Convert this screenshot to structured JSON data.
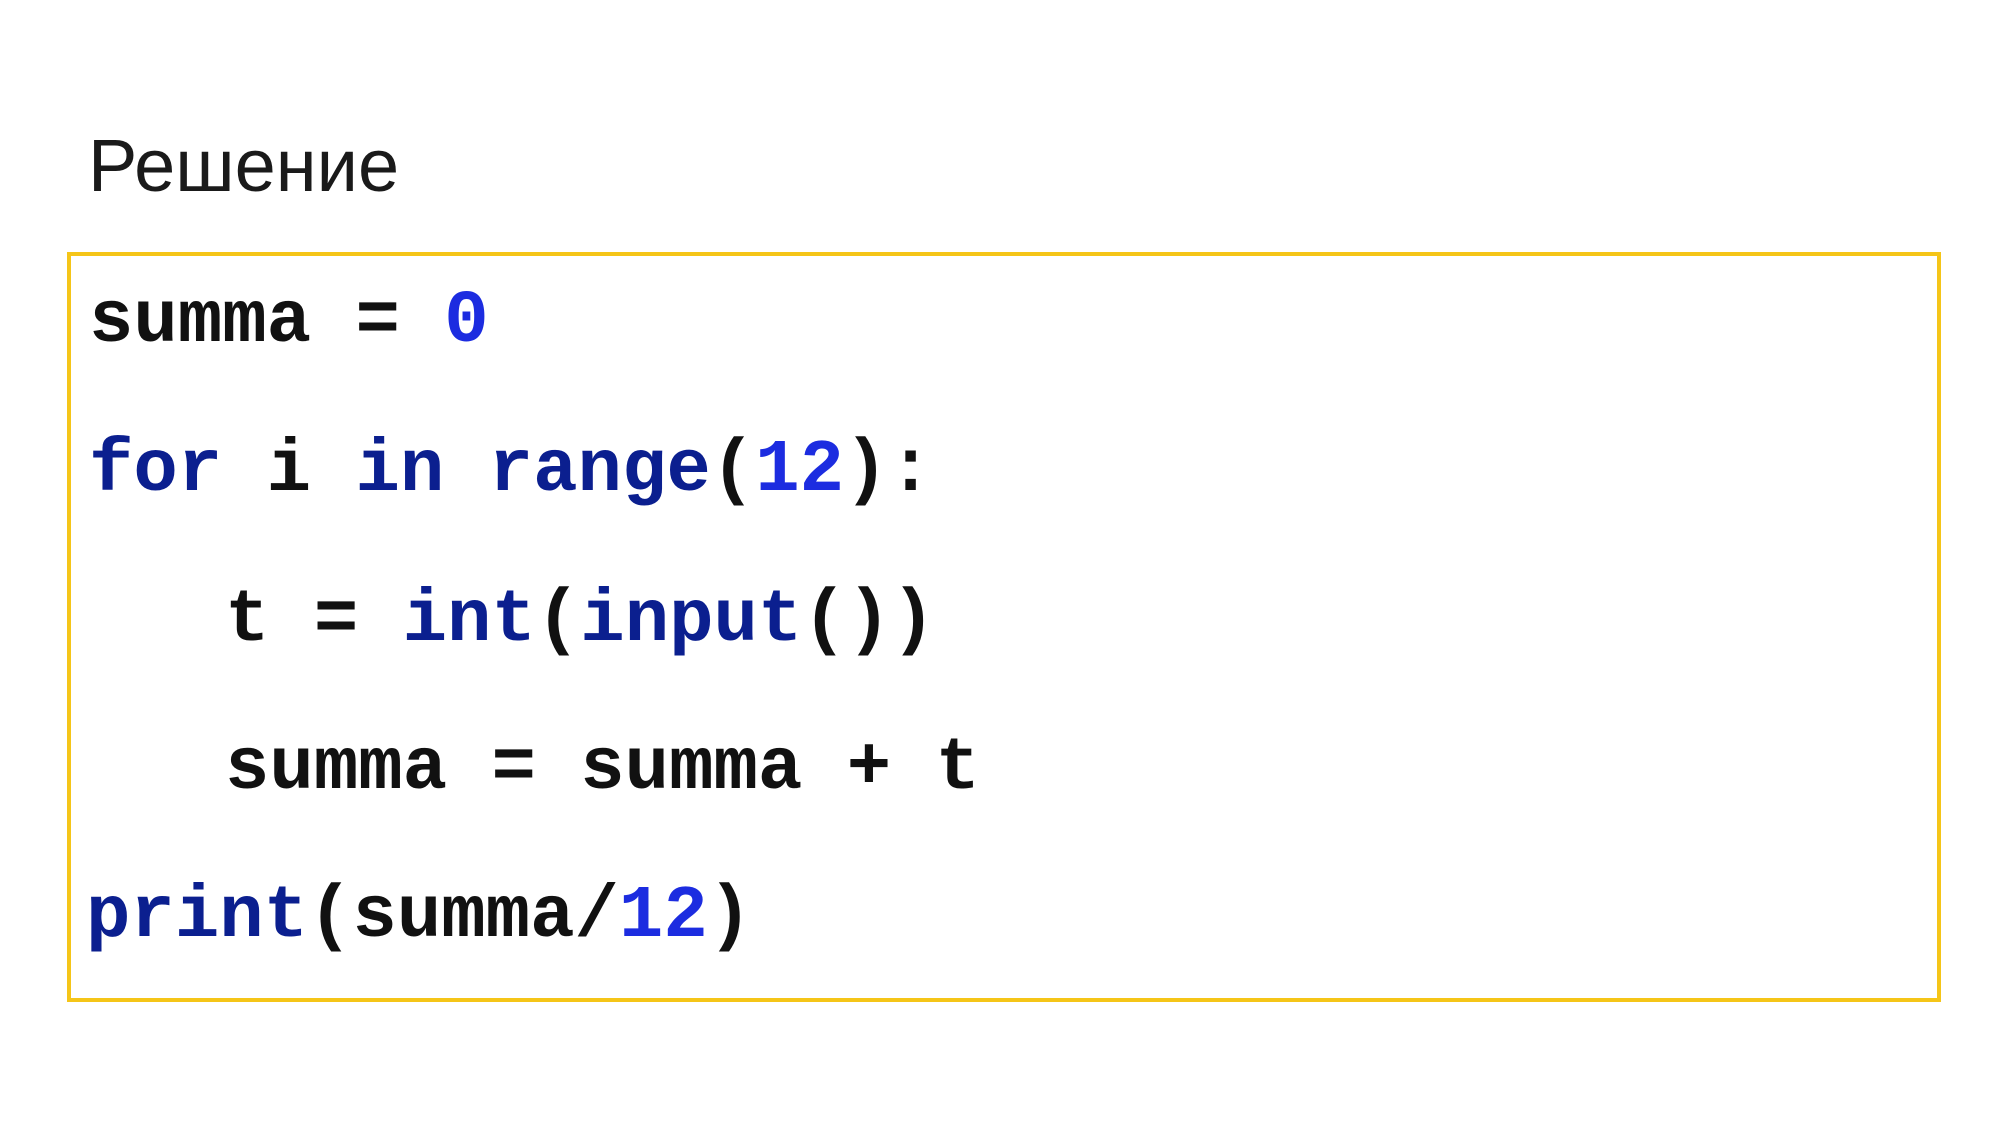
{
  "title": "Решение",
  "code": {
    "lines": [
      [
        {
          "text": "summa = ",
          "kind": "plain"
        },
        {
          "text": "0",
          "kind": "number"
        }
      ],
      [
        {
          "text": "for",
          "kind": "keyword"
        },
        {
          "text": " i ",
          "kind": "plain"
        },
        {
          "text": "in",
          "kind": "keyword"
        },
        {
          "text": " ",
          "kind": "plain"
        },
        {
          "text": "range",
          "kind": "keyword"
        },
        {
          "text": "(",
          "kind": "plain"
        },
        {
          "text": "12",
          "kind": "number"
        },
        {
          "text": "):",
          "kind": "plain"
        }
      ],
      [
        {
          "text": "t = ",
          "kind": "plain"
        },
        {
          "text": "int",
          "kind": "keyword"
        },
        {
          "text": "(",
          "kind": "plain"
        },
        {
          "text": "input",
          "kind": "keyword"
        },
        {
          "text": "())",
          "kind": "plain"
        }
      ],
      [
        {
          "text": "summa = summa + t",
          "kind": "plain"
        }
      ],
      [
        {
          "text": "print",
          "kind": "keyword"
        },
        {
          "text": "(summa/",
          "kind": "plain"
        },
        {
          "text": "12",
          "kind": "number"
        },
        {
          "text": ")",
          "kind": "plain"
        }
      ]
    ]
  },
  "colors": {
    "border": "#f5c518",
    "keyword": "#0b1f8f",
    "number": "#1c2ce0",
    "plain": "#111111",
    "background": "#ffffff"
  }
}
